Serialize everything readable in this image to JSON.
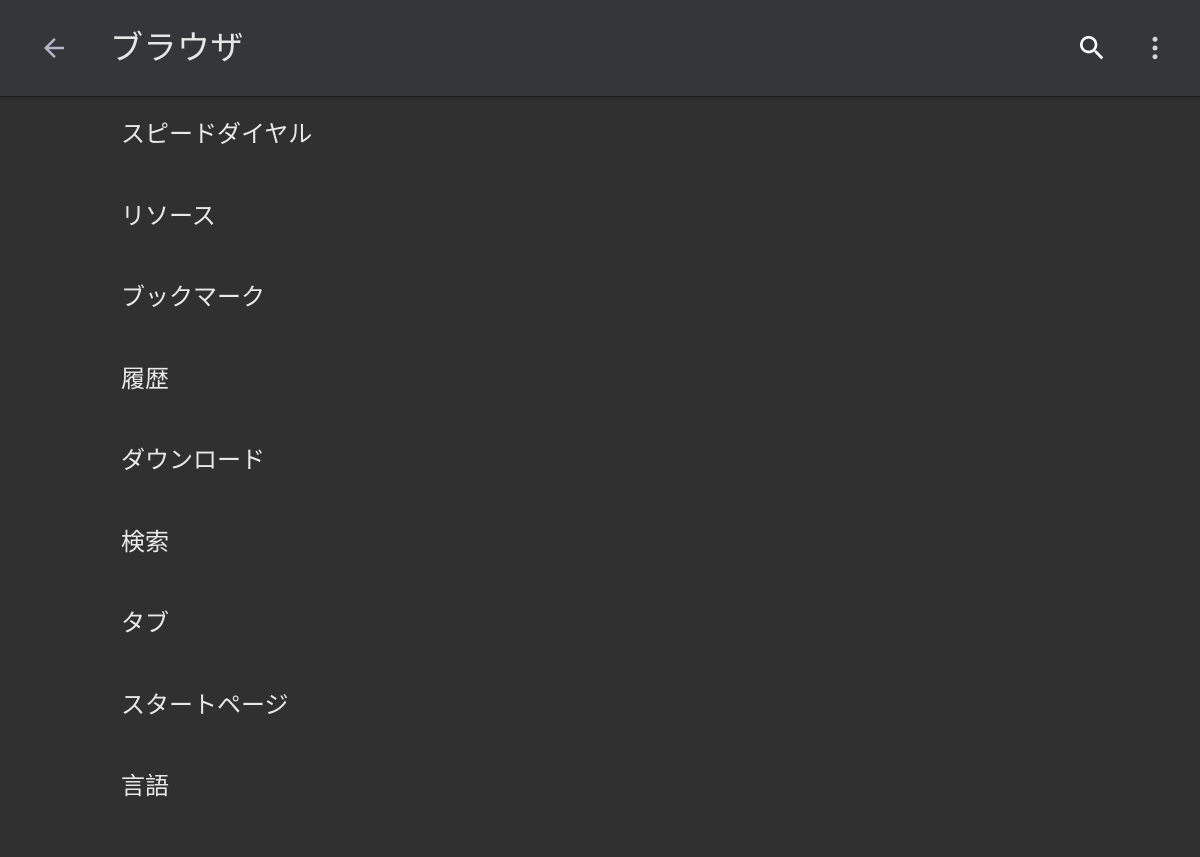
{
  "header": {
    "title": "ブラウザ",
    "back_icon": "arrow-back-icon",
    "search_icon": "search-icon",
    "more_icon": "more-vert-icon"
  },
  "settings": {
    "items": [
      {
        "label": "スピードダイヤル"
      },
      {
        "label": "リソース"
      },
      {
        "label": "ブックマーク"
      },
      {
        "label": "履歴"
      },
      {
        "label": "ダウンロード"
      },
      {
        "label": "検索"
      },
      {
        "label": "タブ"
      },
      {
        "label": "スタートページ"
      },
      {
        "label": "言語"
      }
    ]
  },
  "colors": {
    "background": "#303030",
    "appbar": "#34363a",
    "text": "#e8e8e8",
    "back_icon": "#b9b3cc",
    "icon": "#ffffff"
  }
}
